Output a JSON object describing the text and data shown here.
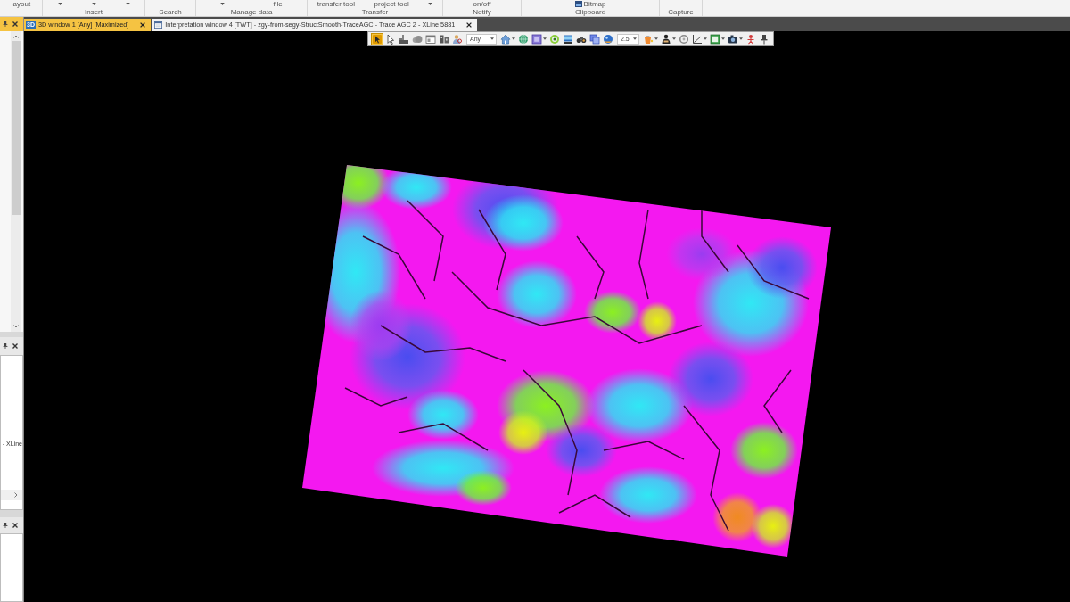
{
  "ribbon": {
    "groups": [
      {
        "items": [
          {
            "kind": "text",
            "label": "layout"
          }
        ]
      },
      {
        "label": "Insert",
        "items": [
          {
            "kind": "caret"
          },
          {
            "kind": "caret"
          },
          {
            "kind": "caret"
          }
        ]
      },
      {
        "label": "Search"
      },
      {
        "label": "Manage data",
        "items": [
          {
            "kind": "caret"
          },
          {
            "kind": "text",
            "label": "file"
          }
        ]
      },
      {
        "label": "Transfer",
        "items": [
          {
            "kind": "text",
            "label": "transfer tool"
          },
          {
            "kind": "text",
            "label": "project tool"
          },
          {
            "kind": "caret"
          }
        ]
      },
      {
        "label": "Notify",
        "items": [
          {
            "kind": "text",
            "label": "on/off"
          }
        ]
      },
      {
        "label": "Clipboard",
        "items": [
          {
            "kind": "icon",
            "label": "Bitmap"
          }
        ]
      },
      {
        "label": "Capture"
      }
    ]
  },
  "side_panels": [
    {
      "active": true
    },
    {
      "active": false,
      "text": "- XLine"
    },
    {
      "active": false
    }
  ],
  "tabs": [
    {
      "badge": "3D",
      "label": "3D window 1 [Any] [Maximized]",
      "selected": true
    },
    {
      "label": "Interpretation window 4 [TWT] - zgy-from-segy-StructSmooth-TraceAGC - Trace AGC 2 - XLine 5881",
      "selected": false
    }
  ],
  "toolbar": {
    "items": [
      {
        "kind": "tool",
        "selected": true
      },
      {
        "kind": "tool",
        "selected": false
      },
      {
        "kind": "tool",
        "selected": false
      },
      {
        "kind": "tool",
        "selected": false
      },
      {
        "kind": "tool",
        "selected": false
      },
      {
        "kind": "tool",
        "selected": false
      },
      {
        "kind": "tool",
        "selected": false
      },
      {
        "kind": "combo",
        "value": "Any"
      },
      {
        "kind": "menu",
        "selected": false
      },
      {
        "kind": "tool",
        "selected": false
      },
      {
        "kind": "menu",
        "selected": false
      },
      {
        "kind": "tool",
        "selected": false
      },
      {
        "kind": "tool",
        "selected": false
      },
      {
        "kind": "tool",
        "selected": false
      },
      {
        "kind": "tool",
        "selected": false
      },
      {
        "kind": "tool",
        "selected": false
      },
      {
        "kind": "combo",
        "value": "2.5"
      },
      {
        "kind": "menu",
        "selected": false
      },
      {
        "kind": "menu",
        "selected": false
      },
      {
        "kind": "tool",
        "selected": false
      },
      {
        "kind": "menu",
        "selected": false
      },
      {
        "kind": "menu",
        "selected": false
      },
      {
        "kind": "menu",
        "selected": false
      },
      {
        "kind": "tool",
        "selected": false
      },
      {
        "kind": "tool",
        "selected": false
      }
    ]
  }
}
